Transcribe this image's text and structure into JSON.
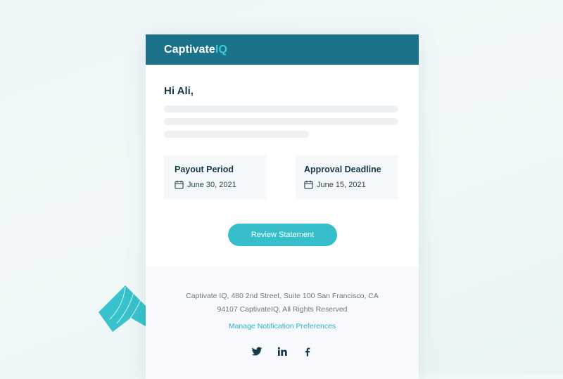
{
  "header": {
    "logo_main": "Captivate",
    "logo_accent": "IQ"
  },
  "email": {
    "greeting": "Hi Ali,",
    "payout": {
      "title": "Payout Period",
      "date": "June 30, 2021"
    },
    "approval": {
      "title": "Approval Deadline",
      "date": "June 15, 2021"
    },
    "cta_label": "Review Statement"
  },
  "footer": {
    "address_line1": "Captivate IQ, 480 2nd Street, Suite 100 San Francisco, CA",
    "address_line2": "94107 CaptivateIQ, All Rights Reserved",
    "manage_link": "Manage Notification Preferences",
    "social_icons": [
      "twitter-icon",
      "linkedin-icon",
      "facebook-icon"
    ]
  },
  "colors": {
    "header_bg": "#1b7288",
    "accent": "#36bfcb",
    "text_dark": "#163a4a"
  }
}
